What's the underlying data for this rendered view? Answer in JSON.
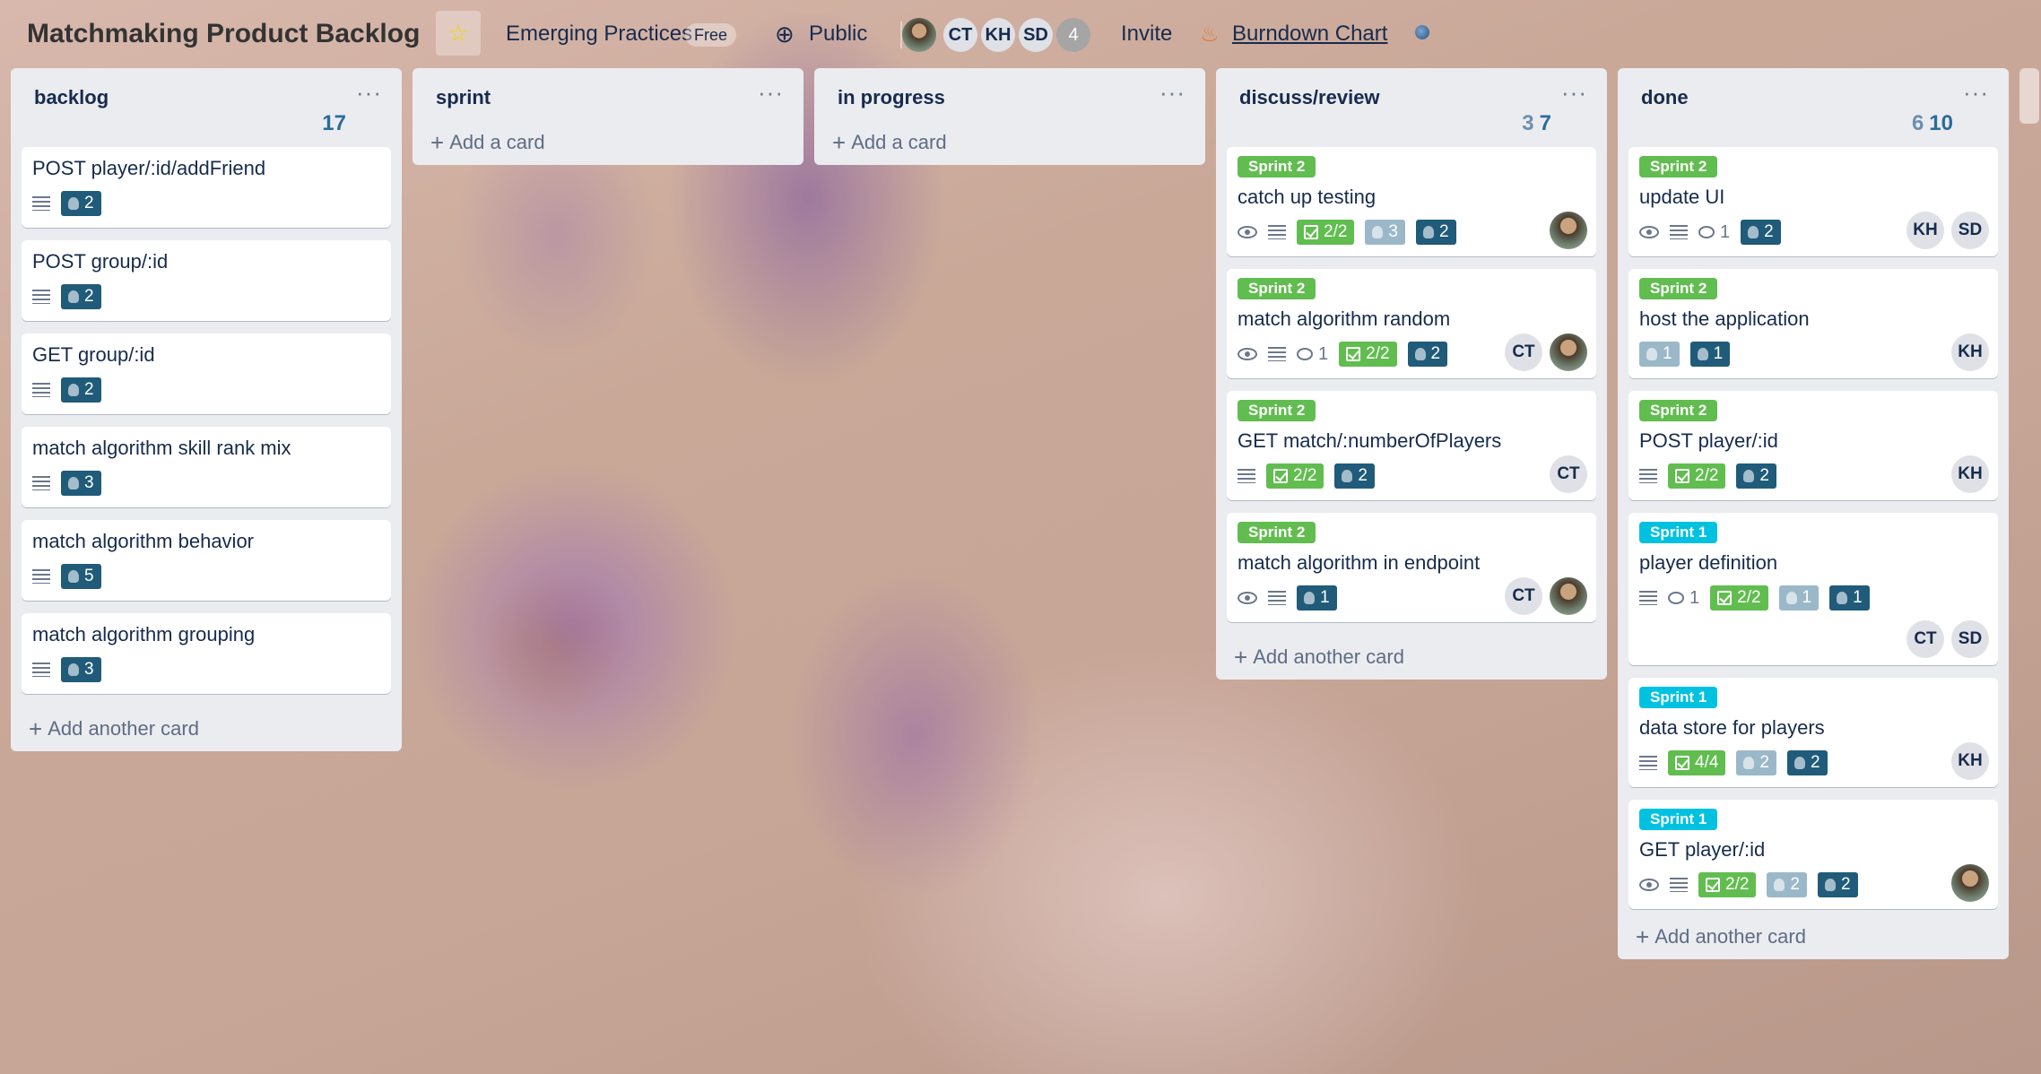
{
  "header": {
    "board_title": "Matchmaking Product Backlog",
    "team": "Emerging Practices",
    "plan_badge": "Free",
    "visibility": "Public",
    "members": [
      "CT",
      "KH",
      "SD"
    ],
    "member_overflow": "4",
    "invite": "Invite",
    "burndown": "Burndown Chart"
  },
  "lists": [
    {
      "name": "backlog",
      "count_a": "",
      "count_b": "17",
      "add": "Add another card",
      "cards": [
        {
          "title": "POST player/:id/addFriend",
          "points": "2"
        },
        {
          "title": "POST group/:id",
          "points": "2"
        },
        {
          "title": "GET group/:id",
          "points": "2"
        },
        {
          "title": "match algorithm skill rank mix",
          "points": "3"
        },
        {
          "title": "match algorithm behavior",
          "points": "5"
        },
        {
          "title": "match algorithm grouping",
          "points": "3"
        }
      ]
    },
    {
      "name": "sprint",
      "add": "Add a card"
    },
    {
      "name": "in progress",
      "add": "Add a card"
    },
    {
      "name": "discuss/review",
      "count_a": "3",
      "count_b": "7",
      "add": "Add another card",
      "cards": [
        {
          "label": "Sprint 2",
          "title": "catch up testing",
          "checklist": "2/2",
          "light_points": "3",
          "points": "2"
        },
        {
          "label": "Sprint 2",
          "title": "match algorithm random",
          "comments": "1",
          "checklist": "2/2",
          "points": "2",
          "member": "CT"
        },
        {
          "label": "Sprint 2",
          "title": "GET match/:numberOfPlayers",
          "checklist": "2/2",
          "points": "2",
          "member": "CT"
        },
        {
          "label": "Sprint 2",
          "title": "match algorithm in endpoint",
          "points": "1",
          "member": "CT"
        }
      ]
    },
    {
      "name": "done",
      "count_a": "6",
      "count_b": "10",
      "add": "Add another card",
      "cards": [
        {
          "label": "Sprint 2",
          "title": "update UI",
          "comments": "1",
          "points": "2",
          "members": [
            "KH",
            "SD"
          ]
        },
        {
          "label": "Sprint 2",
          "title": "host the application",
          "light_points": "1",
          "points": "1",
          "member": "KH"
        },
        {
          "label": "Sprint 2",
          "title": "POST player/:id",
          "checklist": "2/2",
          "points": "2",
          "member": "KH"
        },
        {
          "label": "Sprint 1",
          "title": "player definition",
          "comments": "1",
          "checklist": "2/2",
          "light_points": "1",
          "points": "1",
          "members": [
            "CT",
            "SD"
          ]
        },
        {
          "label": "Sprint 1",
          "title": "data store for players",
          "checklist": "4/4",
          "light_points": "2",
          "points": "2",
          "member": "KH"
        },
        {
          "label": "Sprint 1",
          "title": "GET player/:id",
          "checklist": "2/2",
          "light_points": "2",
          "points": "2"
        }
      ]
    }
  ],
  "colors": {
    "sprint2": "#61bd4f",
    "sprint1": "#00c2e0",
    "points_dark": "#205b7a",
    "points_light": "#9bb8c9"
  }
}
